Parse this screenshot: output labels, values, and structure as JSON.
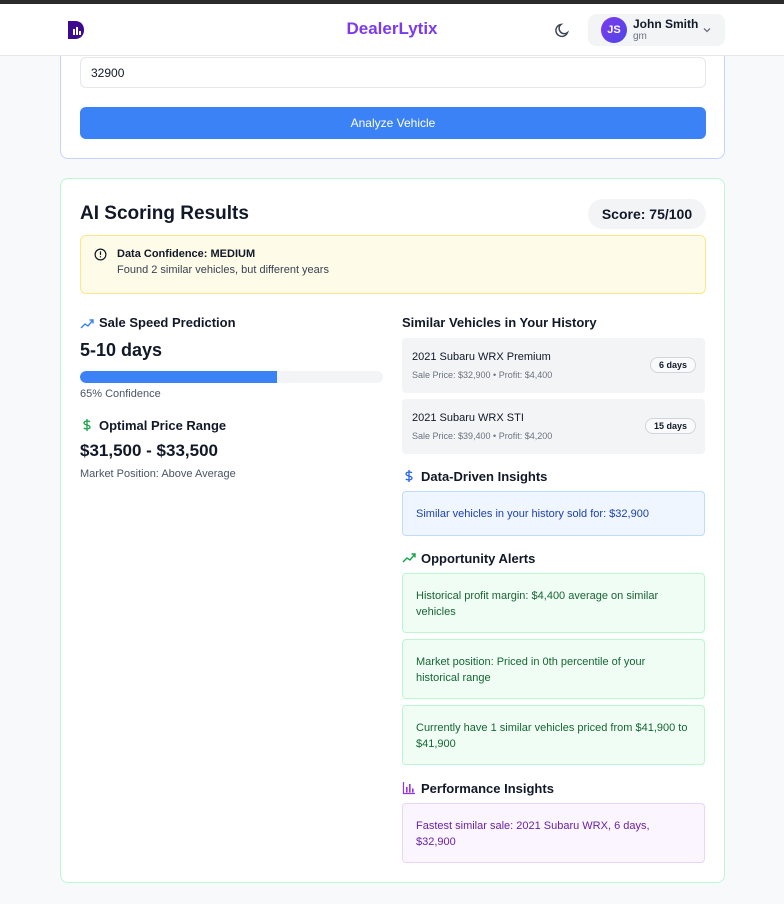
{
  "header": {
    "brand": "DealerLytix",
    "user": {
      "initials": "JS",
      "name": "John Smith",
      "subtitle": "gm"
    }
  },
  "form": {
    "price_value": "32900",
    "analyze_label": "Analyze Vehicle"
  },
  "results": {
    "title": "AI Scoring Results",
    "score": "Score: 75/100",
    "confidence": {
      "title": "Data Confidence: MEDIUM",
      "text": "Found 2 similar vehicles, but different years"
    },
    "sale_speed": {
      "title": "Sale Speed Prediction",
      "value": "5-10 days",
      "confidence_label": "65% Confidence",
      "confidence_fraction": 0.65
    },
    "price_range": {
      "title": "Optimal Price Range",
      "value": "$31,500 - $33,500",
      "market_position": "Market Position: Above Average"
    },
    "similar": {
      "title": "Similar Vehicles in Your History",
      "vehicles": [
        {
          "name": "2021 Subaru WRX Premium",
          "details": "Sale Price: $32,900 • Profit: $4,400",
          "days": "6 days"
        },
        {
          "name": "2021 Subaru WRX STI",
          "details": "Sale Price: $39,400 • Profit: $4,200",
          "days": "15 days"
        }
      ]
    },
    "data_insights": {
      "title": "Data-Driven Insights",
      "items": [
        "Similar vehicles in your history sold for: $32,900"
      ]
    },
    "opportunity": {
      "title": "Opportunity Alerts",
      "items": [
        "Historical profit margin: $4,400 average on similar vehicles",
        "Market position: Priced in 0th percentile of your historical range",
        "Currently have 1 similar vehicles priced from $41,900 to $41,900"
      ]
    },
    "performance": {
      "title": "Performance Insights",
      "items": [
        "Fastest similar sale: 2021 Subaru WRX, 6 days, $32,900"
      ]
    }
  },
  "colors": {
    "brand": "#7c3aed",
    "primary": "#3b82f6",
    "success": "#16a34a",
    "warning_bg": "#fefce8"
  }
}
